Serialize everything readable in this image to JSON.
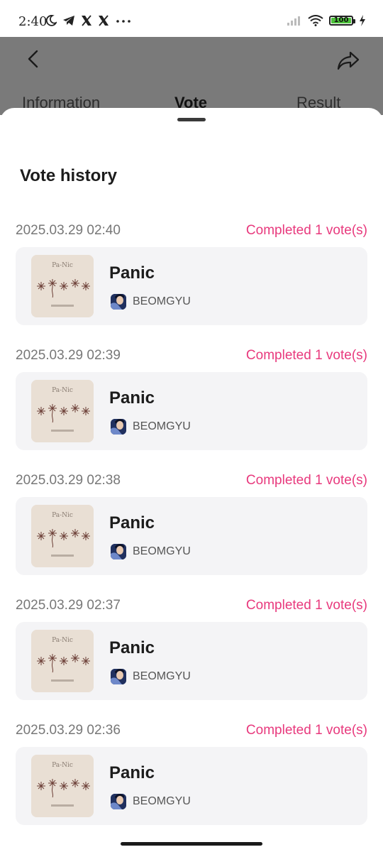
{
  "status_bar": {
    "time": "2:40",
    "battery": "100",
    "icons": [
      "moon-icon",
      "telegram-icon",
      "x-icon",
      "x-icon",
      "more-icon",
      "signal-icon",
      "wifi-icon",
      "battery-icon",
      "charging-icon"
    ]
  },
  "header": {
    "tabs": [
      {
        "label": "Information"
      },
      {
        "label": "Vote"
      },
      {
        "label": "Result"
      }
    ],
    "active_tab": "Vote"
  },
  "sheet": {
    "title": "Vote history",
    "entries": [
      {
        "timestamp": "2025.03.29 02:40",
        "status": "Completed 1 vote(s)",
        "song": "Panic",
        "artist": "BEOMGYU"
      },
      {
        "timestamp": "2025.03.29 02:39",
        "status": "Completed 1 vote(s)",
        "song": "Panic",
        "artist": "BEOMGYU"
      },
      {
        "timestamp": "2025.03.29 02:38",
        "status": "Completed 1 vote(s)",
        "song": "Panic",
        "artist": "BEOMGYU"
      },
      {
        "timestamp": "2025.03.29 02:37",
        "status": "Completed 1 vote(s)",
        "song": "Panic",
        "artist": "BEOMGYU"
      },
      {
        "timestamp": "2025.03.29 02:36",
        "status": "Completed 1 vote(s)",
        "song": "Panic",
        "artist": "BEOMGYU"
      }
    ]
  },
  "album_cover_text": "Pa-Nic",
  "colors": {
    "accent": "#e8397d",
    "card_bg": "#f4f4f6",
    "overlay": "#7a7a7a"
  }
}
